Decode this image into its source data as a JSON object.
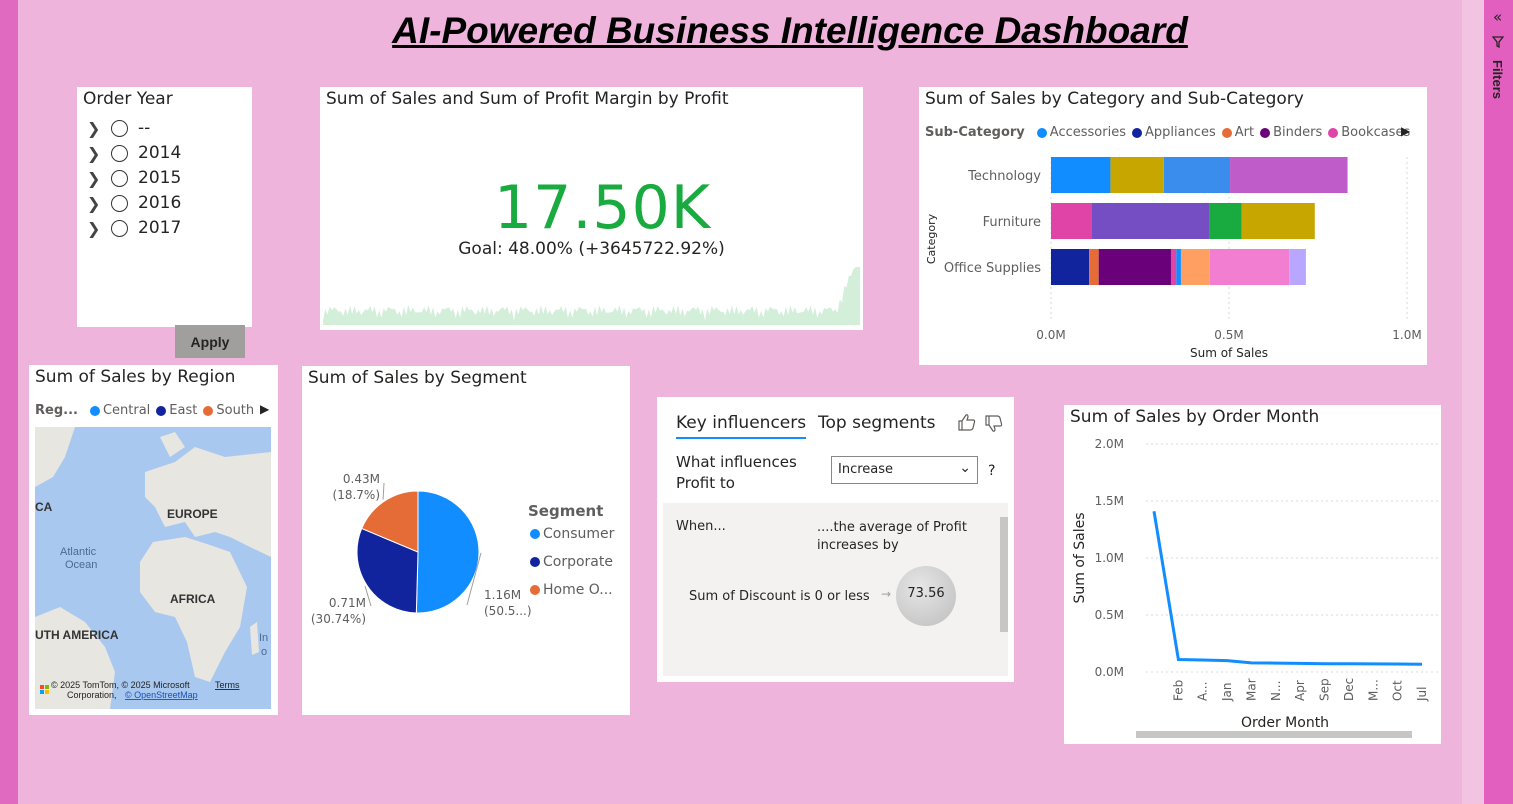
{
  "title": "AI-Powered Business Intelligence Dashboard",
  "filters_pane": {
    "label": "Filters",
    "collapse_icon": "double-chevron-left-icon",
    "filter_icon": "funnel-icon"
  },
  "slicer": {
    "title": "Order Year",
    "items": [
      "--",
      "2014",
      "2015",
      "2016",
      "2017"
    ],
    "apply_label": "Apply"
  },
  "kpi": {
    "title": "Sum of Sales and Sum of Profit Margin by Profit",
    "value": "17.50K",
    "goal": "Goal: 48.00% (+3645722.92%)",
    "value_color": "#1aab40",
    "check_icon": "check-icon"
  },
  "category_chart": {
    "title": "Sum of Sales by Category and Sub-Category",
    "legend_title": "Sub-Category",
    "legend": [
      {
        "name": "Accessories",
        "color": "#118dff"
      },
      {
        "name": "Appliances",
        "color": "#12239e"
      },
      {
        "name": "Art",
        "color": "#e66c37"
      },
      {
        "name": "Binders",
        "color": "#6b007b"
      },
      {
        "name": "Bookcases",
        "color": "#e044a7"
      }
    ],
    "ylabel": "Category",
    "xlabel": "Sum of Sales",
    "x_ticks": [
      "0.0M",
      "0.5M",
      "1.0M"
    ]
  },
  "chart_data": [
    {
      "type": "bar",
      "orientation": "horizontal",
      "stacked": true,
      "title": "Sum of Sales by Category and Sub-Category",
      "xlabel": "Sum of Sales",
      "ylabel": "Category",
      "xlim": [
        0,
        1.0
      ],
      "categories": [
        "Technology",
        "Furniture",
        "Office Supplies"
      ],
      "series": [
        {
          "category": "Technology",
          "values": [
            0.167,
            0.15,
            0.186,
            0.33
          ],
          "colors": [
            "#118dff",
            "#c8a600",
            "#3b8ded",
            "#c05bca"
          ]
        },
        {
          "category": "Furniture",
          "values": [
            0.114,
            0.33,
            0.091,
            0.206
          ],
          "colors": [
            "#e044a7",
            "#744ec2",
            "#1aab40",
            "#c8a600"
          ]
        },
        {
          "category": "Office Supplies",
          "values": [
            0.107,
            0.027,
            0.203,
            0.015,
            0.013,
            0.081,
            0.223,
            0.047
          ],
          "colors": [
            "#12239e",
            "#e66c37",
            "#6b007b",
            "#e044a7",
            "#118dff",
            "#ffa062",
            "#f27ed2",
            "#b8a6ff"
          ]
        }
      ]
    },
    {
      "type": "pie",
      "title": "Sum of Sales by Segment",
      "legend_title": "Segment",
      "slices": [
        {
          "name": "Consumer",
          "value": 1.16,
          "label": "1.16M",
          "pct": "(50.5...)",
          "color": "#118dff"
        },
        {
          "name": "Corporate",
          "value": 0.71,
          "label": "0.71M",
          "pct": "(30.74%)",
          "color": "#12239e"
        },
        {
          "name": "Home Office",
          "legend_label": "Home O...",
          "value": 0.43,
          "label": "0.43M",
          "pct": "(18.7%)",
          "color": "#e66c37"
        }
      ]
    },
    {
      "type": "line",
      "title": "Sum of Sales by Order Month",
      "xlabel": "Order Month",
      "ylabel": "Sum of Sales",
      "ylim": [
        0,
        2.0
      ],
      "y_ticks": [
        "0.0M",
        "0.5M",
        "1.0M",
        "1.5M",
        "2.0M"
      ],
      "categories": [
        "",
        "Feb",
        "A...",
        "Jan",
        "Mar",
        "N...",
        "Apr",
        "Sep",
        "Dec",
        "M...",
        "Oct",
        "Jul"
      ],
      "values": [
        1.41,
        0.11,
        0.105,
        0.1,
        0.08,
        0.078,
        0.075,
        0.073,
        0.072,
        0.071,
        0.07,
        0.068
      ],
      "color": "#118dff"
    }
  ],
  "region": {
    "title": "Sum of Sales by Region",
    "legend_title": "Reg...",
    "legend": [
      {
        "name": "Central",
        "color": "#118dff"
      },
      {
        "name": "East",
        "color": "#12239e"
      },
      {
        "name": "South",
        "color": "#e66c37"
      }
    ],
    "map_labels": {
      "europe": "EUROPE",
      "africa": "AFRICA",
      "south_america": "UTH AMERICA",
      "atlantic1": "Atlantic",
      "atlantic2": "Ocean",
      "ca": "CA",
      "in": "In",
      "o": "o"
    },
    "copyright": "© 2025 TomTom, © 2025 Microsoft",
    "copyright2": "Corporation,",
    "osm": "© OpenStreetMap",
    "terms": "Terms"
  },
  "segment": {
    "title": "Sum of Sales by Segment",
    "legend_title": "Segment"
  },
  "influencers": {
    "tab1": "Key influencers",
    "tab2": "Top segments",
    "question": "What influences Profit to",
    "dropdown_value": "Increase",
    "help": "?",
    "when_label": "When...",
    "avg_label": "....the average of Profit increases by",
    "condition": "Sum of Discount is 0 or less",
    "value": "73.56"
  },
  "month_chart": {
    "title": "Sum of Sales by Order Month"
  }
}
